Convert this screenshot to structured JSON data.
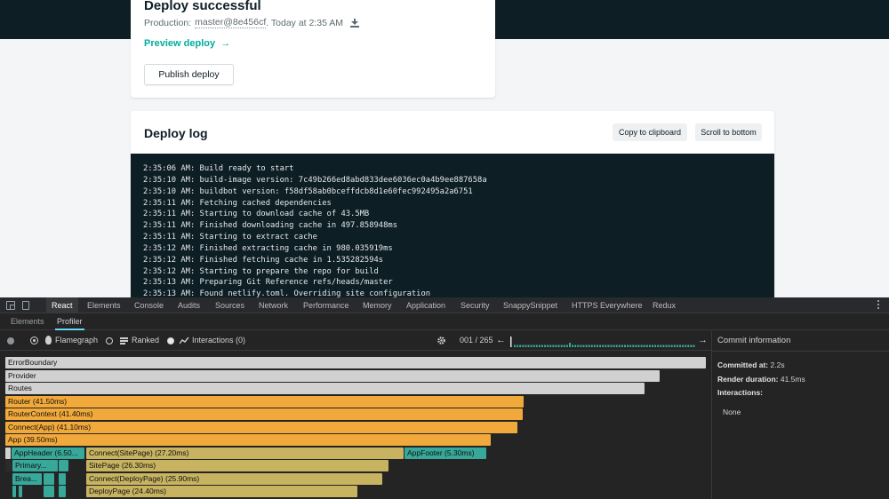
{
  "deploy": {
    "title": "Deploy successful",
    "context": "Production:",
    "ref": "master@8e456cf",
    "time": ". Today at 2:35 AM",
    "preview_label": "Preview deploy",
    "preview_arrow": "→",
    "publish_label": "Publish deploy"
  },
  "log": {
    "title": "Deploy log",
    "copy_label": "Copy to clipboard",
    "scroll_label": "Scroll to bottom",
    "lines": [
      "2:35:06 AM: Build ready to start",
      "2:35:10 AM: build-image version: 7c49b266ed8abd833dee6036ec0a4b9ee887658a",
      "2:35:10 AM: buildbot version: f58df58ab0bceffdcb8d1e60fec992495a2a6751",
      "2:35:11 AM: Fetching cached dependencies",
      "2:35:11 AM: Starting to download cache of 43.5MB",
      "2:35:11 AM: Finished downloading cache in 497.858948ms",
      "2:35:11 AM: Starting to extract cache",
      "2:35:12 AM: Finished extracting cache in 980.035919ms",
      "2:35:12 AM: Finished fetching cache in 1.535282594s",
      "2:35:12 AM: Starting to prepare the repo for build",
      "2:35:13 AM: Preparing Git Reference refs/heads/master",
      "2:35:13 AM: Found netlify.toml. Overriding site configuration"
    ]
  },
  "devtools": {
    "tabs": [
      "React",
      "Elements",
      "Console",
      "Audits",
      "Sources",
      "Network",
      "Performance",
      "Memory",
      "Application",
      "Security",
      "SnappySnippet",
      "HTTPS Everywhere",
      "Redux"
    ],
    "active_tab": "React",
    "subtabs": [
      "Elements",
      "Profiler"
    ],
    "active_subtab": "Profiler",
    "toolbar": {
      "flamegraph": "Flamegraph",
      "ranked": "Ranked",
      "interactions": "Interactions (0)",
      "counter": "001 / 265",
      "prev": "←",
      "next": "→"
    },
    "flame_bars": [
      {
        "label": "ErrorBoundary",
        "color": "gray"
      },
      {
        "label": "Provider",
        "color": "gray"
      },
      {
        "label": "Routes",
        "color": "gray"
      },
      {
        "label": "Router (41.50ms)",
        "color": "orange"
      },
      {
        "label": "RouterContext (41.40ms)",
        "color": "orange"
      },
      {
        "label": "Connect(App) (41.10ms)",
        "color": "orange"
      },
      {
        "label": "App (39.50ms)",
        "color": "orange"
      },
      {
        "label": "AppHeader (6.50...",
        "color": "teal"
      },
      {
        "label": "Connect(SitePage) (27.20ms)",
        "color": "khaki"
      },
      {
        "label": "AppFooter (5.30ms)",
        "color": "teal"
      },
      {
        "label": "Primary...",
        "color": "teal"
      },
      {
        "label": "SitePage (26.30ms)",
        "color": "khaki"
      },
      {
        "label": "Brea...",
        "color": "teal"
      },
      {
        "label": "Connect(DeployPage) (25.90ms)",
        "color": "khaki"
      },
      {
        "label": "DeployPage (24.40ms)",
        "color": "khaki"
      }
    ],
    "commit_info": {
      "title": "Commit information",
      "committed_label": "Committed at:",
      "committed_value": "2.2s",
      "render_label": "Render duration:",
      "render_value": "41.5ms",
      "interactions_label": "Interactions:",
      "interactions_value": "None"
    }
  },
  "colors": {
    "accent": "#00ad9f",
    "header_dark": "#0e1e25",
    "react_blue": "#61dafb",
    "flame_orange": "#f2a93b",
    "flame_khaki": "#c7b360",
    "flame_teal": "#37a899"
  }
}
